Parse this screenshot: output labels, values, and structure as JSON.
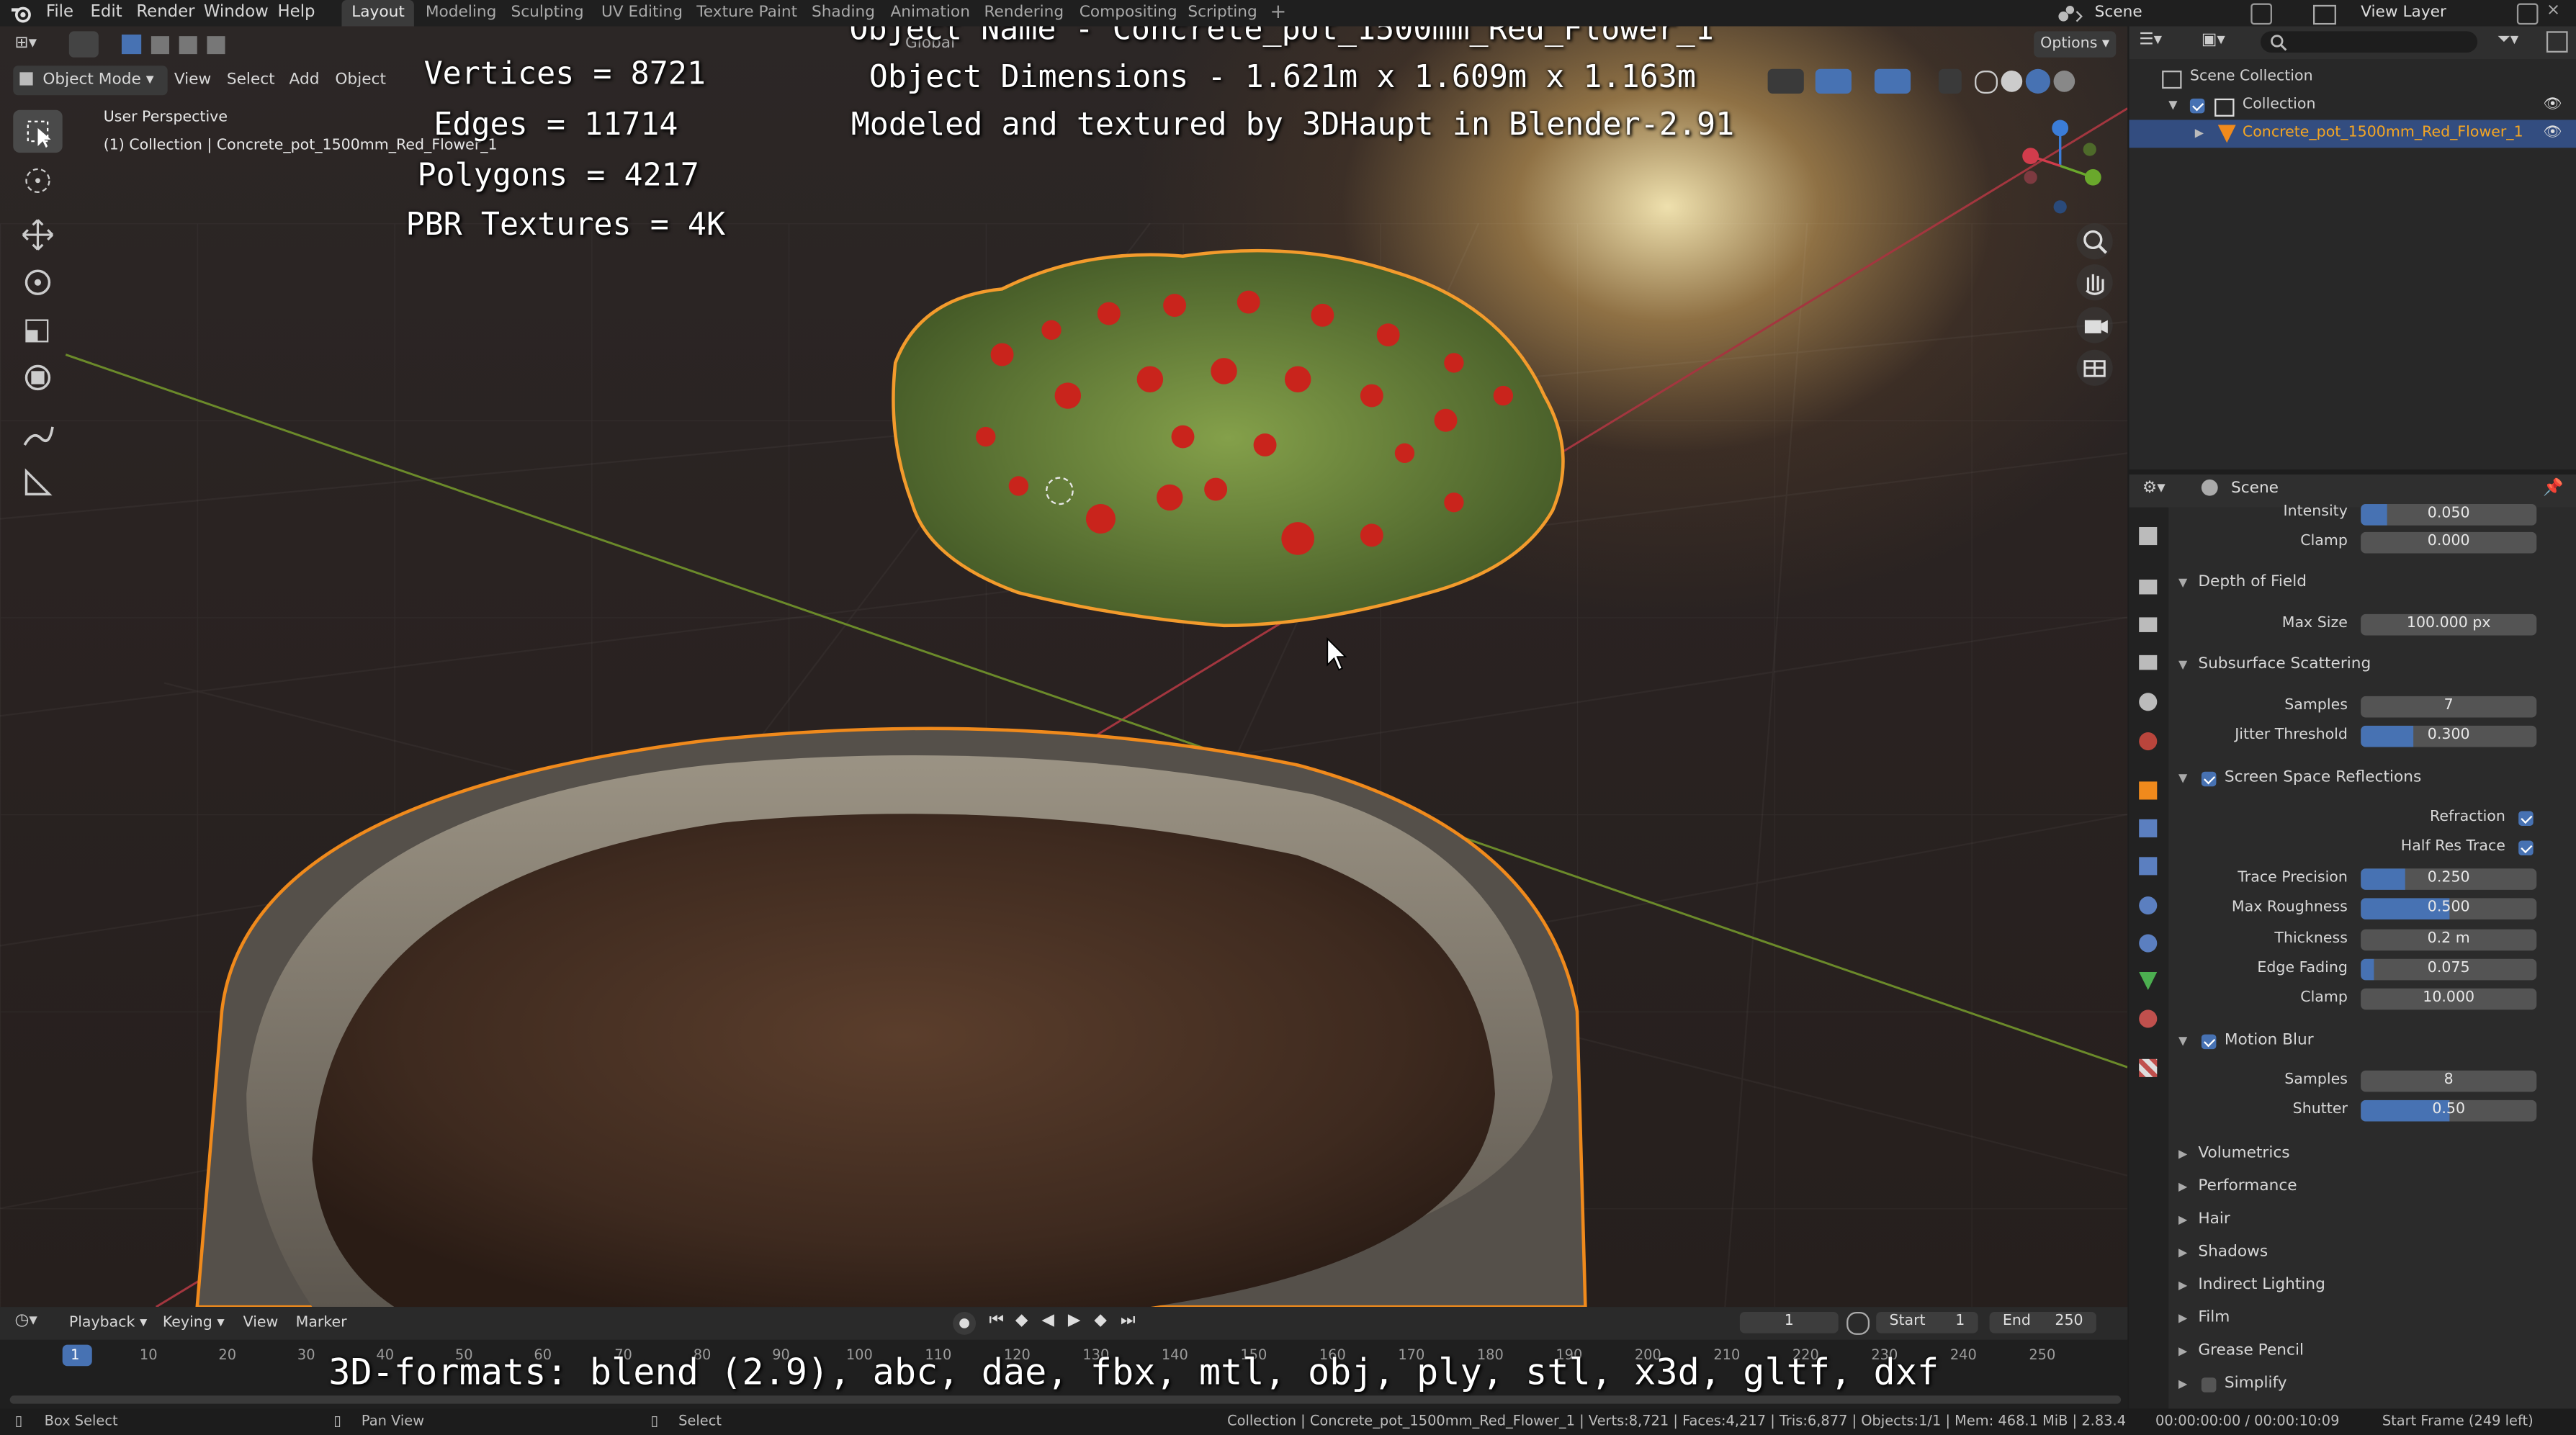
{
  "top_menu": [
    "File",
    "Edit",
    "Render",
    "Window",
    "Help"
  ],
  "workspace_tabs": [
    "Layout",
    "Modeling",
    "Sculpting",
    "UV Editing",
    "Texture Paint",
    "Shading",
    "Animation",
    "Rendering",
    "Compositing",
    "Scripting"
  ],
  "active_workspace": "Layout",
  "scene_name": "Scene",
  "view_layer_name": "View Layer",
  "viewport": {
    "mode": "Object Mode",
    "menus": [
      "View",
      "Select",
      "Add",
      "Object"
    ],
    "orientation": "Global",
    "options_label": "Options",
    "perspective_label": "User Perspective",
    "collection_label": "(1) Collection | Concrete_pot_1500mm_Red_Flower_1"
  },
  "overlay": {
    "vertices": "Vertices = 8721",
    "edges": "Edges = 11714",
    "polygons": "Polygons = 4217",
    "pbr": "PBR Textures = 4K",
    "object_name": "Object Name - Concrete_pot_1500mm_Red_Flower_1",
    "dimensions": "Object Dimensions -  1.621m x 1.609m x 1.163m",
    "credit": "Modeled and textured by 3DHaupt in Blender-2.91",
    "formats": "3D-formats: blend (2.9), abc, dae, fbx, mtl, obj, ply, stl, x3d, gltf, dxf"
  },
  "outliner": {
    "root": "Scene Collection",
    "collection": "Collection",
    "object": "Concrete_pot_1500mm_Red_Flower_1"
  },
  "properties": {
    "header": "Scene",
    "rows": [
      {
        "label": "Intensity",
        "value": "0.050",
        "fill": 0.15
      },
      {
        "label": "Clamp",
        "value": "0.000",
        "fill": 0
      }
    ],
    "dof": {
      "title": "Depth of Field",
      "max_size_label": "Max Size",
      "max_size": "100.000 px"
    },
    "sss": {
      "title": "Subsurface Scattering",
      "samples_label": "Samples",
      "samples": "7",
      "jitter_label": "Jitter Threshold",
      "jitter": "0.300",
      "jitter_fill": 0.3
    },
    "ssr": {
      "title": "Screen Space Reflections",
      "refraction": "Refraction",
      "half_res": "Half Res Trace",
      "fields": [
        {
          "label": "Trace Precision",
          "value": "0.250",
          "fill": 0.25
        },
        {
          "label": "Max Roughness",
          "value": "0.500",
          "fill": 0.5
        },
        {
          "label": "Thickness",
          "value": "0.2 m",
          "fill": 0
        },
        {
          "label": "Edge Fading",
          "value": "0.075",
          "fill": 0.075
        },
        {
          "label": "Clamp",
          "value": "10.000",
          "fill": 0
        }
      ]
    },
    "motion_blur": {
      "title": "Motion Blur",
      "samples_label": "Samples",
      "samples": "8",
      "shutter_label": "Shutter",
      "shutter": "0.50",
      "shutter_fill": 0.5
    },
    "collapsed": [
      "Volumetrics",
      "Performance",
      "Hair",
      "Shadows",
      "Indirect Lighting",
      "Film",
      "Grease Pencil",
      "Simplify"
    ]
  },
  "timeline": {
    "menus": [
      "Playback",
      "Keying",
      "View",
      "Marker"
    ],
    "current_frame": "1",
    "start_label": "Start",
    "start": "1",
    "end_label": "End",
    "end": "250",
    "ticks": [
      "1",
      "10",
      "20",
      "30",
      "40",
      "50",
      "60",
      "70",
      "80",
      "90",
      "100",
      "110",
      "120",
      "130",
      "140",
      "150",
      "160",
      "170",
      "180",
      "190",
      "200",
      "210",
      "220",
      "230",
      "240",
      "250"
    ]
  },
  "status": {
    "box_select": "Box Select",
    "pan_view": "Pan View",
    "select": "Select",
    "stats": "Collection | Concrete_pot_1500mm_Red_Flower_1 | Verts:8,721 | Faces:4,217 | Tris:6,877 | Objects:1/1 | Mem: 468.1 MiB | 2.83.4",
    "time": "00:00:00:00 / 00:00:10:09",
    "start_frame": "Start Frame (249 left)"
  },
  "colors": {
    "accent": "#4772b3",
    "selection_outline": "#f08a1c",
    "active_orange": "#f5a623"
  }
}
